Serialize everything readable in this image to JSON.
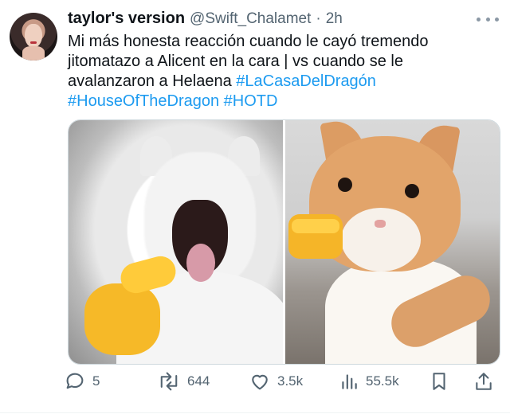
{
  "tweet": {
    "author": {
      "display_name": "taylor's version",
      "handle": "@Swift_Chalamet",
      "separator": "·",
      "time": "2h"
    },
    "text": {
      "line1": "Mi más honesta reacción cuando le cayó tremendo",
      "line2": "jitomatazo a Alicent en la cara | vs cuando se le",
      "line3_prefix": "avalanzaron a Helaena ",
      "hashtags": [
        "#LaCasaDelDragón",
        "#HouseOfTheDragon",
        "#HOTD"
      ]
    },
    "media": {
      "left_icon": "screaming-cat-pointing-emoji-image",
      "right_icon": "orange-cat-fist-bump-emoji-image"
    },
    "actions": {
      "replies": "5",
      "retweets": "644",
      "likes": "3.5k",
      "views": "55.5k"
    },
    "icons": {
      "reply": "reply-icon",
      "retweet": "retweet-icon",
      "like": "heart-icon",
      "views": "views-icon",
      "bookmark": "bookmark-icon",
      "share": "share-icon",
      "more": "more-icon"
    },
    "colors": {
      "link": "#1d9bf0",
      "secondary": "#536471",
      "text": "#0f1419"
    }
  }
}
